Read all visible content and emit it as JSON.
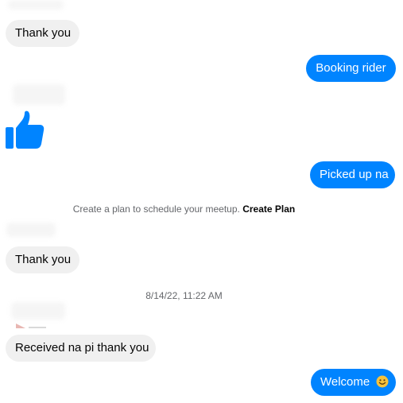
{
  "messages": [
    {
      "id": "m1",
      "text": "Thank you"
    },
    {
      "id": "m2",
      "text": "Booking rider"
    },
    {
      "id": "m3",
      "text": "Picked up na"
    },
    {
      "id": "m4",
      "text": "Thank you"
    },
    {
      "id": "m5",
      "text": "Received na pi thank you"
    },
    {
      "id": "m6",
      "text": "Welcome"
    }
  ],
  "system_note": {
    "text": "Create a plan to schedule your meetup.",
    "link": "Create Plan"
  },
  "timestamp": "8/14/22, 11:22 AM",
  "icons": {
    "like": "thumbs-up-icon",
    "emoji": "smiley-emoji-icon"
  },
  "colors": {
    "outgoing_bubble": "#0084ff",
    "incoming_bubble": "#f0f0f0",
    "like_icon": "#0084ff"
  }
}
